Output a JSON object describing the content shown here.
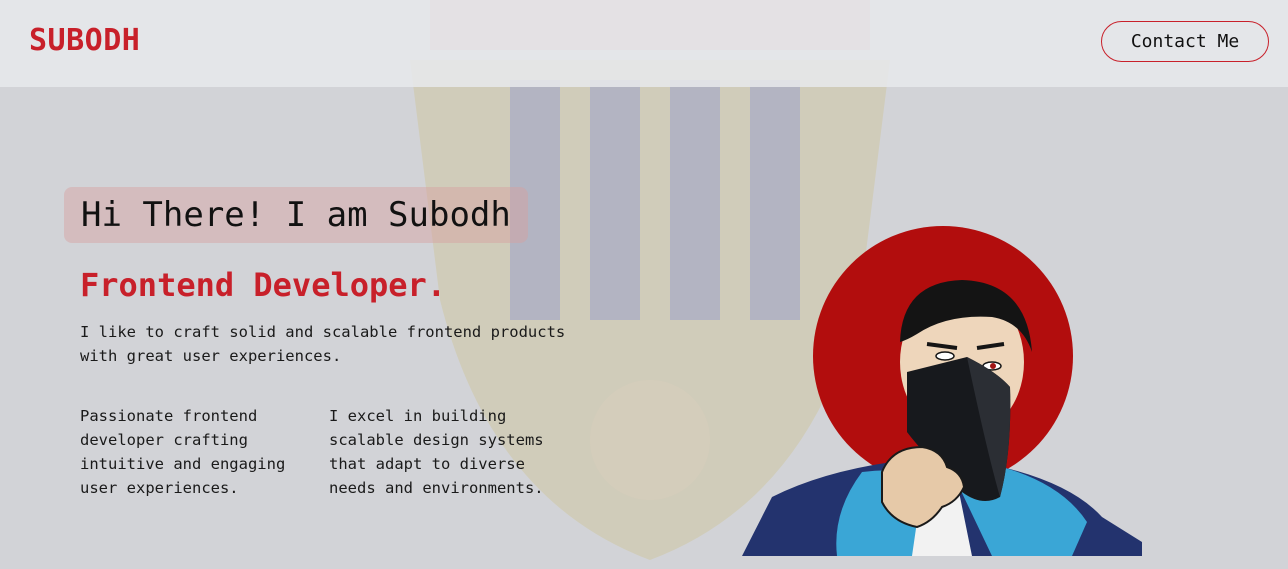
{
  "navbar": {
    "logo": "SUBODH",
    "contact_label": "Contact Me"
  },
  "hero": {
    "greeting": "Hi There! I am Subodh",
    "role": "Frontend Developer.",
    "intro": "I like to craft solid and scalable frontend products with great user experiences.",
    "column_left": "Passionate frontend developer crafting intuitive and engaging user experiences.",
    "column_right": "I excel in building scalable design systems that adapt to diverse needs and environments."
  },
  "colors": {
    "accent": "#c8202a",
    "background": "#d2d3d7",
    "greeting_bg": "#d6a0a0"
  },
  "icons": {
    "background": "crest-watermark",
    "portrait": "avatar-illustration"
  }
}
